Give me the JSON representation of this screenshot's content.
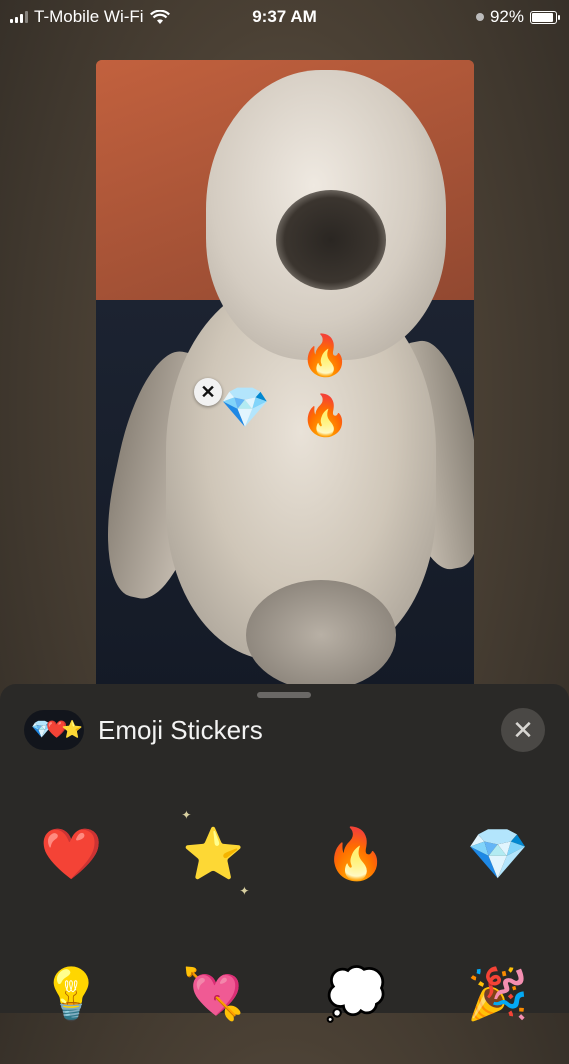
{
  "status_bar": {
    "carrier": "T-Mobile Wi-Fi",
    "time": "9:37 AM",
    "battery_percent": "92%",
    "battery_level": 0.92
  },
  "photo": {
    "stickers": [
      {
        "name": "fire-sticker",
        "glyph": "🔥"
      },
      {
        "name": "fire-sticker",
        "glyph": "🔥"
      },
      {
        "name": "gem-sticker",
        "glyph": "💎"
      }
    ],
    "remove_glyph": "✕"
  },
  "sheet": {
    "icon_glyphs": "💎❤️⭐",
    "title": "Emoji Stickers",
    "close_glyph": "✕",
    "stickers": [
      [
        "❤️",
        "⭐",
        "🔥",
        "💎"
      ],
      [
        "💡",
        "💘",
        "💭",
        "🎉"
      ]
    ]
  },
  "colors": {
    "sheet_bg": "#2a2927",
    "photo_wall": "#b35a3a"
  }
}
